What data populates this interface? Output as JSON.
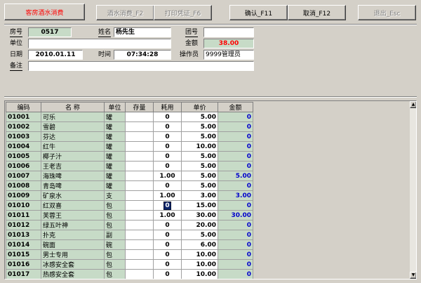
{
  "toolbar": {
    "title": "客房酒水消费",
    "buttons": [
      {
        "label": "酒水消费_F2",
        "enabled": false
      },
      {
        "label": "打印凭证_F6",
        "enabled": false
      },
      {
        "label": "确认_F11",
        "enabled": true
      },
      {
        "label": "取消_F12",
        "enabled": true
      },
      {
        "label": "退出_Esc",
        "enabled": false
      }
    ]
  },
  "form": {
    "room_label": "房号",
    "room_value": "0517",
    "name_label": "姓名",
    "name_value": "杨先生",
    "group_label": "团号",
    "group_value": "",
    "unit_label": "单位",
    "unit_value": "",
    "amount_label": "金额",
    "amount_value": "38.00",
    "date_label": "日期",
    "date_value": "2010.01.11",
    "time_label": "时间",
    "time_value": "07:34:28",
    "operator_label": "操作员",
    "operator_value": "9999管理员",
    "remark_label": "备注",
    "remark_value": ""
  },
  "grid": {
    "columns": [
      "编码",
      "名 称",
      "单位",
      "存量",
      "耗用",
      "单价",
      "金额"
    ],
    "rows": [
      {
        "code": "01001",
        "name": "可乐",
        "unit": "罐",
        "stock": "",
        "use": "0",
        "price": "5.00",
        "amount": "0"
      },
      {
        "code": "01002",
        "name": "雪碧",
        "unit": "罐",
        "stock": "",
        "use": "0",
        "price": "5.00",
        "amount": "0"
      },
      {
        "code": "01003",
        "name": "芬达",
        "unit": "罐",
        "stock": "",
        "use": "0",
        "price": "5.00",
        "amount": "0"
      },
      {
        "code": "01004",
        "name": "红牛",
        "unit": "罐",
        "stock": "",
        "use": "0",
        "price": "10.00",
        "amount": "0"
      },
      {
        "code": "01005",
        "name": "椰子汁",
        "unit": "罐",
        "stock": "",
        "use": "0",
        "price": "5.00",
        "amount": "0"
      },
      {
        "code": "01006",
        "name": "王老吉",
        "unit": "罐",
        "stock": "",
        "use": "0",
        "price": "5.00",
        "amount": "0"
      },
      {
        "code": "01007",
        "name": "海珠啤",
        "unit": "罐",
        "stock": "",
        "use": "1.00",
        "price": "5.00",
        "amount": "5.00"
      },
      {
        "code": "01008",
        "name": "青岛啤",
        "unit": "罐",
        "stock": "",
        "use": "0",
        "price": "5.00",
        "amount": "0"
      },
      {
        "code": "01009",
        "name": "矿泉水",
        "unit": "支",
        "stock": "",
        "use": "1.00",
        "price": "3.00",
        "amount": "3.00"
      },
      {
        "code": "01010",
        "name": "红双喜",
        "unit": "包",
        "stock": "",
        "use": "0",
        "price": "15.00",
        "amount": "0"
      },
      {
        "code": "01011",
        "name": "芙蓉王",
        "unit": "包",
        "stock": "",
        "use": "1.00",
        "price": "30.00",
        "amount": "30.00"
      },
      {
        "code": "01012",
        "name": "绿五叶神",
        "unit": "包",
        "stock": "",
        "use": "0",
        "price": "20.00",
        "amount": "0"
      },
      {
        "code": "01013",
        "name": "扑克",
        "unit": "副",
        "stock": "",
        "use": "0",
        "price": "5.00",
        "amount": "0"
      },
      {
        "code": "01014",
        "name": "碗面",
        "unit": "碗",
        "stock": "",
        "use": "0",
        "price": "6.00",
        "amount": "0"
      },
      {
        "code": "01015",
        "name": "男士专用",
        "unit": "包",
        "stock": "",
        "use": "0",
        "price": "10.00",
        "amount": "0"
      },
      {
        "code": "01016",
        "name": "冰感安全套",
        "unit": "包",
        "stock": "",
        "use": "0",
        "price": "10.00",
        "amount": "0"
      },
      {
        "code": "01017",
        "name": "热感安全套",
        "unit": "包",
        "stock": "",
        "use": "0",
        "price": "10.00",
        "amount": "0"
      }
    ],
    "focused_row": 9
  },
  "scrollbar": {
    "up_glyph": "▲",
    "down_glyph": "▼"
  }
}
